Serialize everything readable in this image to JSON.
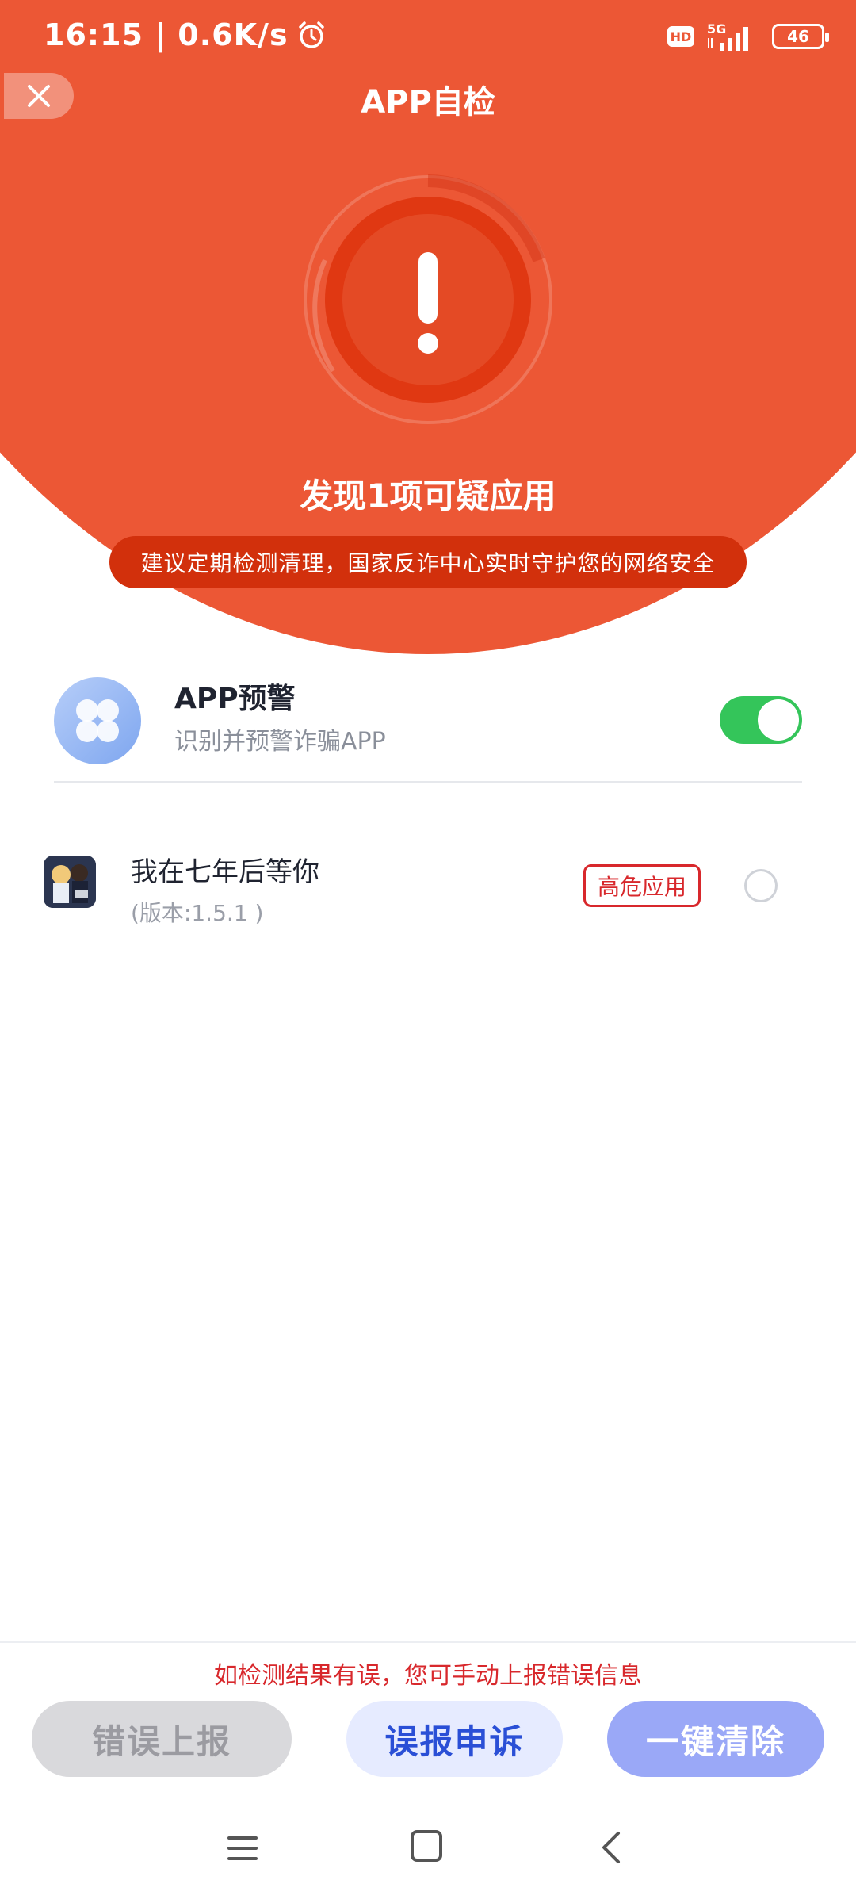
{
  "status_bar": {
    "time_speed": "16:15 | 0.6K/s",
    "hd_badge": "HD",
    "network": "5G",
    "battery": "46"
  },
  "header": {
    "title": "APP自检"
  },
  "scan_result": {
    "title": "发现1项可疑应用",
    "advice": "建议定期检测清理，国家反诈中心实时守护您的网络安全"
  },
  "feature": {
    "title": "APP预警",
    "subtitle": "识别并预警诈骗APP",
    "enabled": true
  },
  "apps": [
    {
      "name": "我在七年后等你",
      "version": "(版本:1.5.1 )",
      "risk_label": "高危应用",
      "selected": false
    }
  ],
  "footer": {
    "hint": "如检测结果有误，您可手动上报错误信息",
    "report_label": "错误上报",
    "appeal_label": "误报申诉",
    "clear_label": "一键清除"
  },
  "colors": {
    "header_orange": "#ec5735",
    "danger_red": "#d8282c",
    "toggle_green": "#34c55a",
    "primary_blue": "#2a4fd6"
  }
}
